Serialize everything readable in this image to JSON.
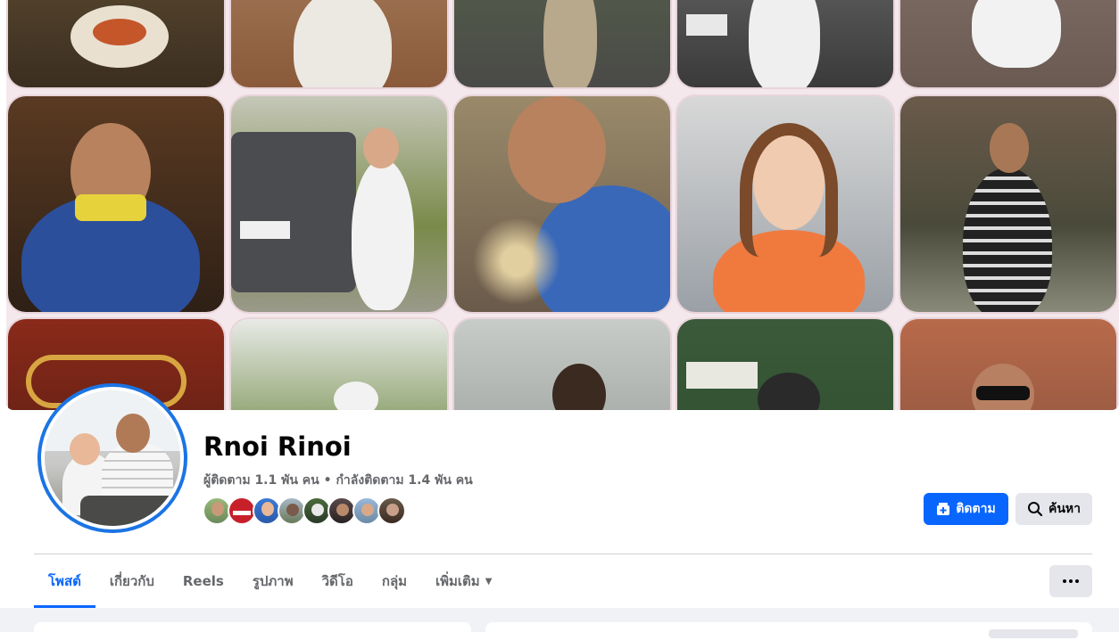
{
  "profile": {
    "name": "Rnoi Rinoi",
    "followers_text": "ผู้ติดตาม 1.1 พัน คน",
    "separator": "•",
    "following_text": "กำลังติดตาม 1.4 พัน คน"
  },
  "actions": {
    "follow_label": "ติดตาม",
    "search_label": "ค้นหา"
  },
  "tabs": [
    {
      "label": "โพสต์",
      "active": true
    },
    {
      "label": "เกี่ยวกับ",
      "active": false
    },
    {
      "label": "Reels",
      "active": false
    },
    {
      "label": "รูปภาพ",
      "active": false
    },
    {
      "label": "วิดีโอ",
      "active": false
    },
    {
      "label": "กลุ่ม",
      "active": false
    },
    {
      "label": "เพิ่มเติม",
      "active": false
    }
  ],
  "colors": {
    "accent": "#0866ff",
    "secondary_button": "#e4e6eb",
    "muted_text": "#65676b",
    "page_bg": "#f0f2f5"
  },
  "icons": {
    "follow": "person-add-icon",
    "search": "search-icon",
    "more_tab": "caret-down-icon",
    "overflow": "more-horizontal-icon"
  },
  "mutual_friends_count_shown": 8
}
